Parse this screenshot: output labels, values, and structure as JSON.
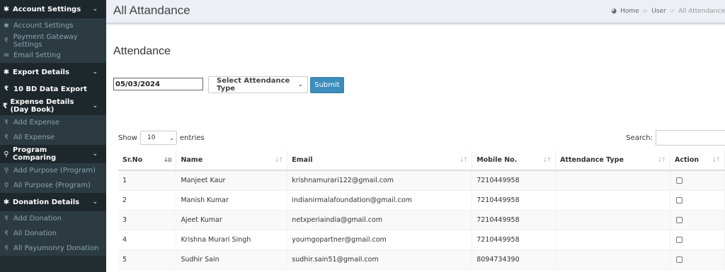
{
  "sidebar": {
    "groups": [
      {
        "label": "Account Settings",
        "icon": "gear-icon",
        "items": [
          {
            "label": "Account Settings",
            "icon": "gear-icon"
          },
          {
            "label": "Payment Gateway Settings",
            "icon": "rupee-icon"
          },
          {
            "label": "Email Setting",
            "icon": "envelope-icon"
          }
        ]
      },
      {
        "label": "Export Details",
        "icon": "gear-icon",
        "items": [
          {
            "label": "10 BD Data Export",
            "icon": "rupee-icon"
          }
        ]
      },
      {
        "label": "Expense Details (Day Book)",
        "icon": "rupee-icon",
        "items": [
          {
            "label": "Add Expense",
            "icon": "rupee-icon"
          },
          {
            "label": "All Expense",
            "icon": "rupee-icon"
          }
        ]
      },
      {
        "label": "Program Comparing",
        "icon": "map-pin-icon",
        "items": [
          {
            "label": "Add Purpose (Program)",
            "icon": "map-pin-icon"
          },
          {
            "label": "All Purpose (Program)",
            "icon": "map-pin-icon"
          }
        ]
      },
      {
        "label": "Donation Details",
        "icon": "gear-icon",
        "items": [
          {
            "label": "Add Donation",
            "icon": "rupee-icon"
          },
          {
            "label": "All Donation",
            "icon": "rupee-icon"
          },
          {
            "label": "All Payumonry Donation",
            "icon": "rupee-icon"
          }
        ]
      }
    ]
  },
  "header": {
    "title": "All Attandance",
    "breadcrumb": {
      "home": "Home",
      "user": "User",
      "current": "All Attendance"
    }
  },
  "form": {
    "section_title": "Attendance",
    "date_value": "05/03/2024",
    "attendance_type": "Select Attendance Type",
    "submit_label": "Submit"
  },
  "table_controls": {
    "show_label": "Show",
    "entries_value": "10",
    "entries_label": "entries",
    "search_label": "Search:"
  },
  "table": {
    "headers": {
      "srno": "Sr.No",
      "name": "Name",
      "email": "Email",
      "mobile": "Mobile No.",
      "type": "Attendance Type",
      "action": "Action"
    },
    "rows": [
      {
        "srno": "1",
        "name": "Manjeet Kaur",
        "email": "krishnamurari122@gmail.com",
        "mobile": "7210449958",
        "type": ""
      },
      {
        "srno": "2",
        "name": "Manish Kumar",
        "email": "indianirmalafoundation@gmail.com",
        "mobile": "7210449958",
        "type": ""
      },
      {
        "srno": "3",
        "name": "Ajeet Kumar",
        "email": "netxperiaindia@gmail.com",
        "mobile": "7210449958",
        "type": ""
      },
      {
        "srno": "4",
        "name": "Krishna Murari Singh",
        "email": "yourngopartner@gmail.com",
        "mobile": "7210449958",
        "type": ""
      },
      {
        "srno": "5",
        "name": "Sudhir Sain",
        "email": "sudhir.sain51@gmail.com",
        "mobile": "8094734390",
        "type": ""
      }
    ]
  }
}
